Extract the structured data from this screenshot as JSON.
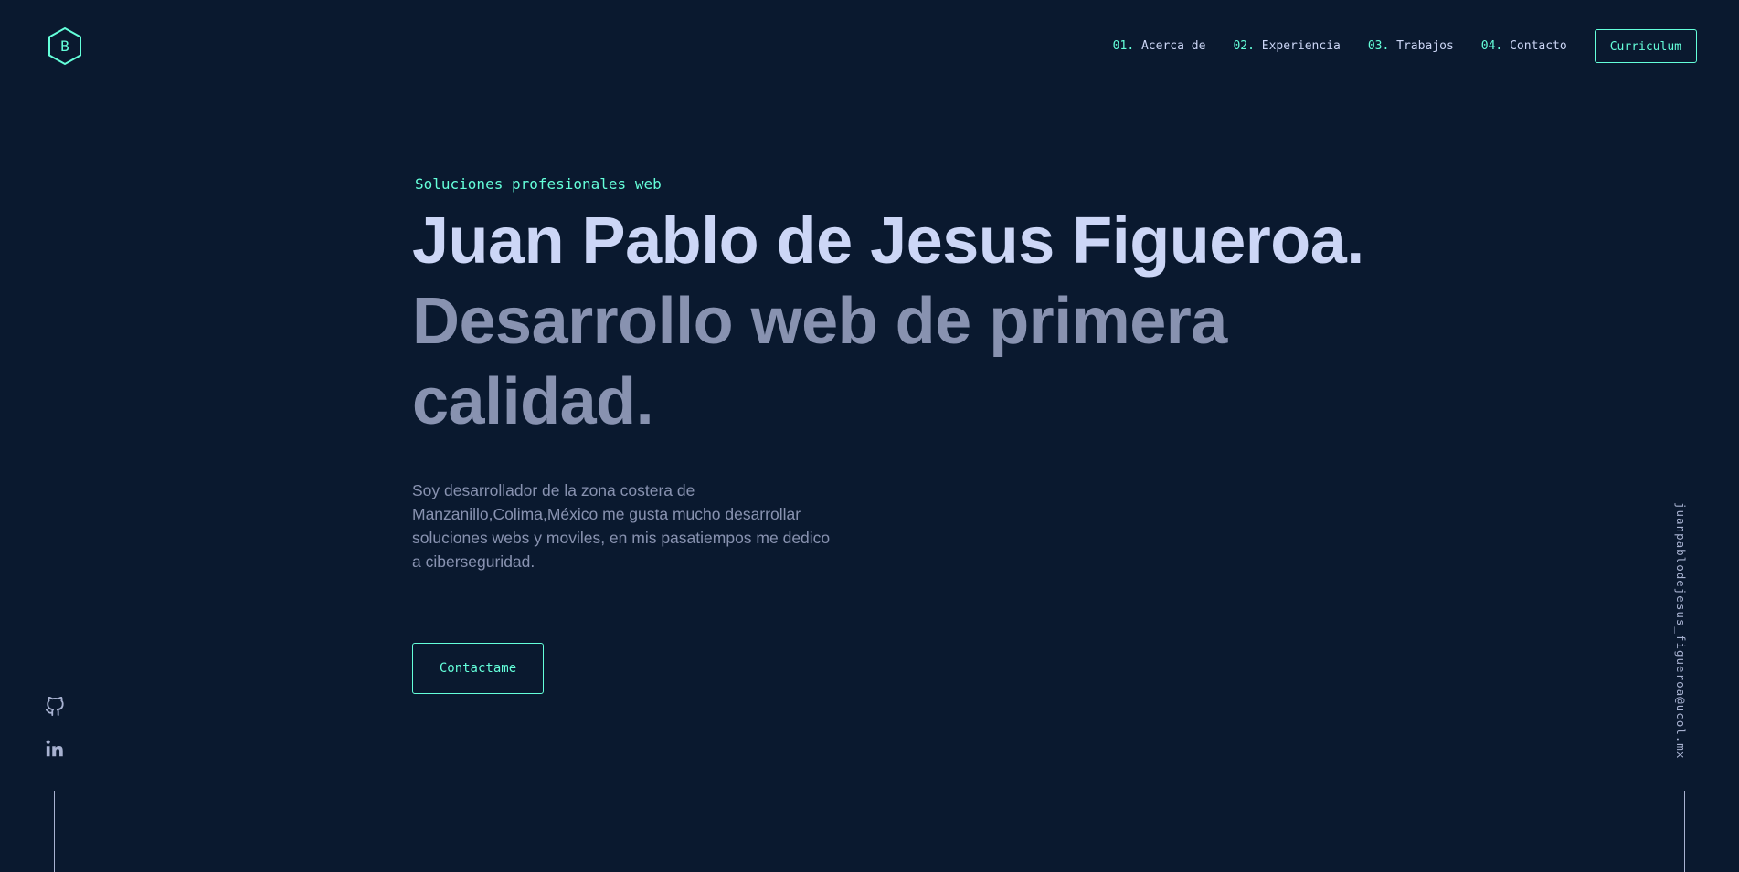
{
  "header": {
    "logo_letter": "B",
    "nav": [
      {
        "num": "01.",
        "label": "Acerca de"
      },
      {
        "num": "02.",
        "label": "Experiencia"
      },
      {
        "num": "03.",
        "label": "Trabajos"
      },
      {
        "num": "04.",
        "label": "Contacto"
      }
    ],
    "resume_label": "Curriculum"
  },
  "hero": {
    "intro": "Soluciones profesionales web",
    "name": "Juan Pablo de Jesus Figueroa.",
    "tagline": "Desarrollo web de primera calidad.",
    "description": "Soy desarrollador de la zona costera de Manzanillo,Colima,México me gusta mucho desarrollar soluciones webs y moviles, en mis pasatiempos me dedico a ciberseguridad.",
    "cta_label": "Contactame"
  },
  "social": {
    "icons": [
      "github-icon",
      "linkedin-icon"
    ]
  },
  "email": "juanpablodejesus_figueroa@ucol.mx",
  "colors": {
    "background": "#0a192f",
    "accent": "#64ffda",
    "heading": "#ccd6f6",
    "text": "#8892b0"
  }
}
